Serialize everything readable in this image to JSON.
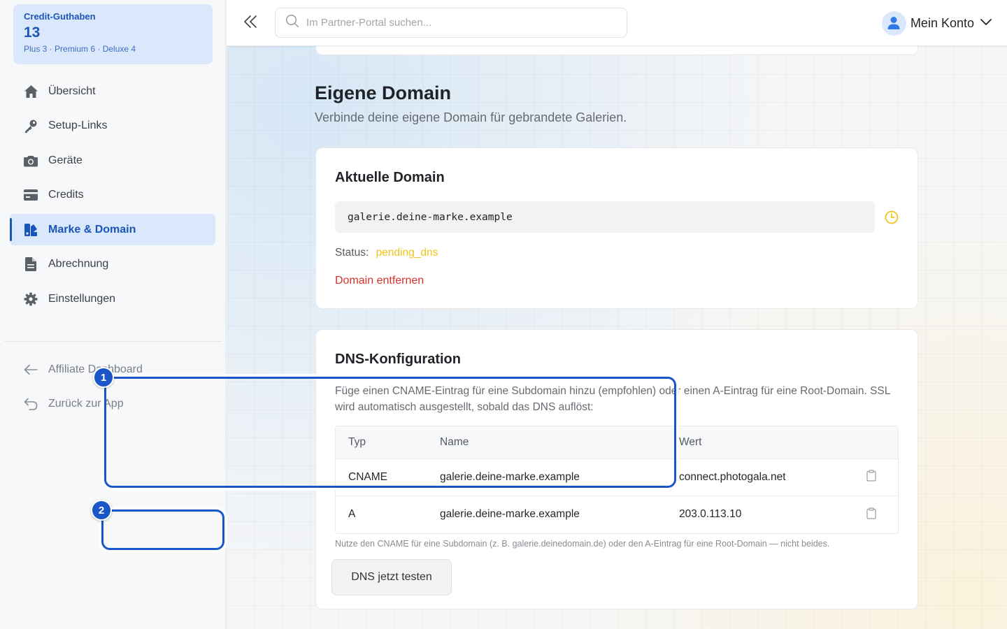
{
  "sidebar": {
    "credit": {
      "title": "Credit-Guthaben",
      "value": "13",
      "breakdown": "Plus 3 · Premium 6 · Deluxe 4"
    },
    "items": [
      {
        "label": "Übersicht",
        "icon": "home-icon"
      },
      {
        "label": "Setup-Links",
        "icon": "key-icon"
      },
      {
        "label": "Geräte",
        "icon": "camera-icon"
      },
      {
        "label": "Credits",
        "icon": "card-icon"
      },
      {
        "label": "Marke & Domain",
        "icon": "brand-icon",
        "active": true
      },
      {
        "label": "Abrechnung",
        "icon": "document-icon"
      },
      {
        "label": "Einstellungen",
        "icon": "gear-icon"
      }
    ],
    "secondary": [
      {
        "label": "Affiliate Dashboard",
        "icon": "arrow-left-icon"
      },
      {
        "label": "Zurück zur App",
        "icon": "undo-arrow-icon"
      }
    ]
  },
  "topbar": {
    "search_placeholder": "Im Partner-Portal suchen...",
    "account_label": "Mein Konto"
  },
  "page": {
    "title": "Eigene Domain",
    "subtitle": "Verbinde deine eigene Domain für gebrandete Galerien."
  },
  "current_domain": {
    "title": "Aktuelle Domain",
    "domain": "galerie.deine-marke.example",
    "status_label": "Status:",
    "status_value": "pending_dns",
    "remove_label": "Domain entfernen"
  },
  "dns": {
    "title": "DNS-Konfiguration",
    "description": "Füge einen CNAME-Eintrag für eine Subdomain hinzu (empfohlen) oder einen A-Eintrag für eine Root-Domain. SSL wird automatisch ausgestellt, sobald das DNS auflöst:",
    "columns": [
      "Typ",
      "Name",
      "Wert"
    ],
    "rows": [
      {
        "type": "CNAME",
        "name": "galerie.deine-marke.example",
        "value": "connect.photogala.net"
      },
      {
        "type": "A",
        "name": "galerie.deine-marke.example",
        "value": "203.0.113.10"
      }
    ],
    "hint": "Nutze den CNAME für eine Subdomain (z. B. galerie.deinedomain.de) oder den A-Eintrag für eine Root-Domain — nicht beides.",
    "test_button": "DNS jetzt testen"
  },
  "annotations": {
    "badge1": "1",
    "badge2": "2"
  },
  "colors": {
    "accent": "#1a56c8",
    "status_pending": "#f0c419",
    "danger": "#d6312b"
  }
}
